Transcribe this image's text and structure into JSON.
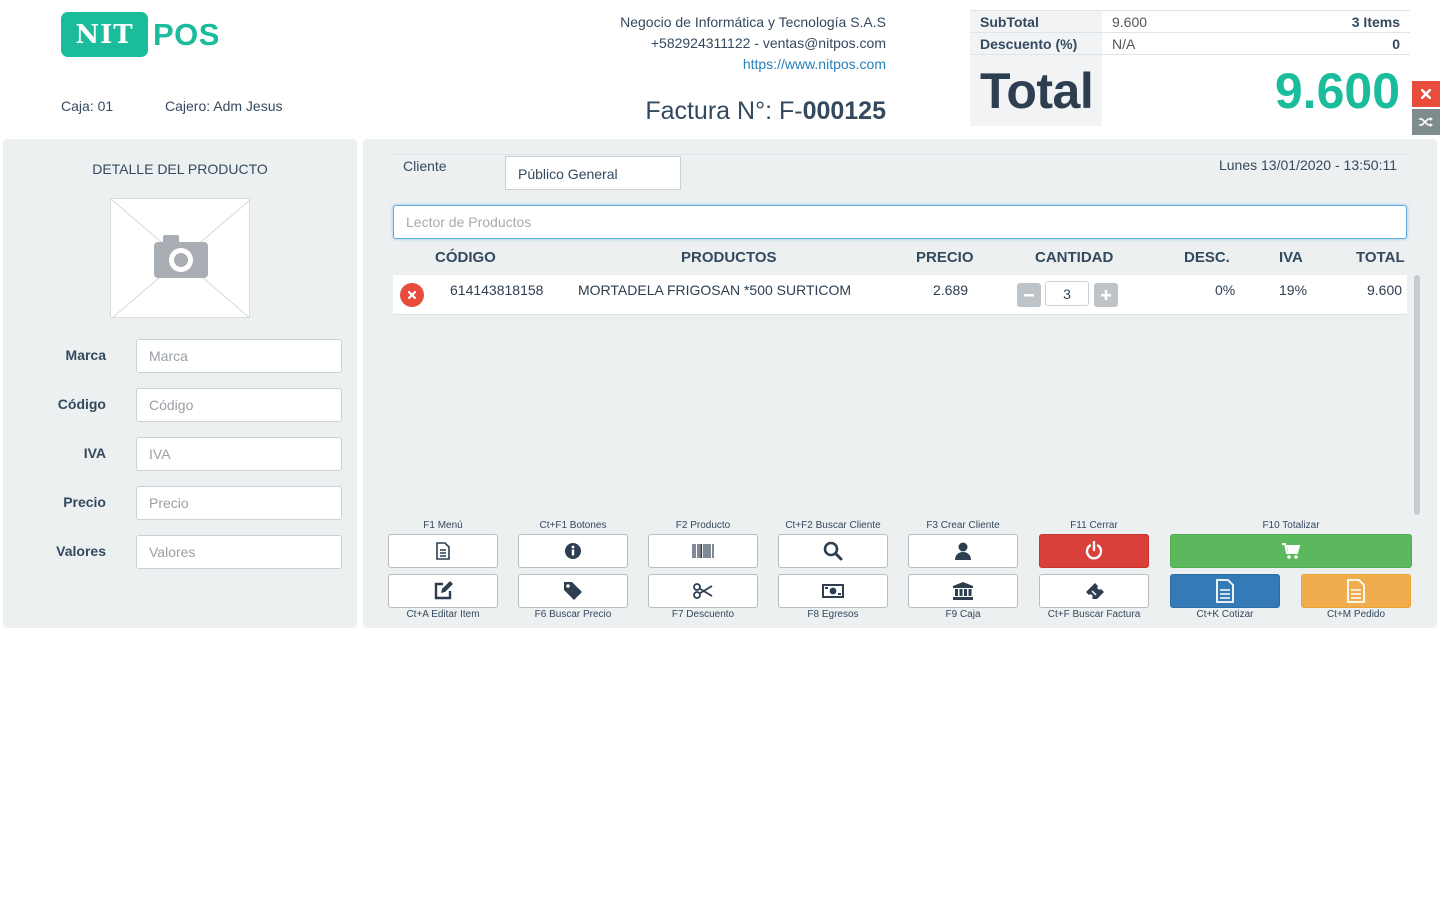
{
  "header": {
    "logo_left": "NIT",
    "logo_right": "POS",
    "caja": "Caja: 01",
    "cajero": "Cajero: Adm Jesus",
    "company_name": "Negocio de Informática y Tecnología S.A.S",
    "company_contact": "+582924311122 - ventas@nitpos.com",
    "company_url": "https://www.nitpos.com",
    "factura_prefix": "Factura N°: F-",
    "factura_number": "000125"
  },
  "totals": {
    "subtotal_label": "SubTotal",
    "subtotal_value": "9.600",
    "items": "3 Items",
    "descuento_label": "Descuento (%)",
    "descuento_value": "N/A",
    "descuento_amount": "0",
    "total_label": "Total",
    "total_value": "9.600"
  },
  "side_buttons": {
    "close_icon": "close-icon",
    "shuffle_icon": "shuffle-icon"
  },
  "detalle": {
    "title": "DETALLE DEL PRODUCTO",
    "photo_icon": "camera-icon",
    "fields": [
      {
        "label": "Marca",
        "placeholder": "Marca"
      },
      {
        "label": "Código",
        "placeholder": "Código"
      },
      {
        "label": "IVA",
        "placeholder": "IVA"
      },
      {
        "label": "Precio",
        "placeholder": "Precio"
      },
      {
        "label": "Valores",
        "placeholder": "Valores"
      }
    ]
  },
  "sale": {
    "cliente_label": "Cliente",
    "cliente_value": "Público General",
    "fecha": "Lunes 13/01/2020 - 13:50:11",
    "lector_placeholder": "Lector de Productos",
    "columns": [
      "CÓDIGO",
      "PRODUCTOS",
      "PRECIO",
      "CANTIDAD",
      "DESC.",
      "IVA",
      "TOTAL"
    ],
    "rows": [
      {
        "codigo": "614143818158",
        "producto": "MORTADELA FRIGOSAN *500 SURTICOM",
        "precio": "2.689",
        "cantidad": "3",
        "desc": "0%",
        "iva": "19%",
        "total": "9.600"
      }
    ]
  },
  "function_keys": {
    "top": [
      {
        "label": "F1 Menú",
        "icon": "document-icon"
      },
      {
        "label": "Ct+F1 Botones",
        "icon": "info-icon"
      },
      {
        "label": "F2 Producto",
        "icon": "barcode-icon"
      },
      {
        "label": "Ct+F2 Buscar Cliente",
        "icon": "search-icon"
      },
      {
        "label": "F3 Crear Cliente",
        "icon": "user-icon"
      },
      {
        "label": "F11 Cerrar",
        "icon": "power-icon"
      },
      {
        "label": "F10 Totalizar",
        "icon": "cart-icon"
      }
    ],
    "bottom": [
      {
        "label": "Ct+A Editar Item",
        "icon": "edit-icon"
      },
      {
        "label": "F6 Buscar Precio",
        "icon": "tag-icon"
      },
      {
        "label": "F7 Descuento",
        "icon": "scissors-icon"
      },
      {
        "label": "F8 Egresos",
        "icon": "money-icon"
      },
      {
        "label": "F9 Caja",
        "icon": "bank-icon"
      },
      {
        "label": "Ct+F Buscar Factura",
        "icon": "ticket-icon"
      },
      {
        "label": "Ct+K Cotizar",
        "icon": "document-icon"
      },
      {
        "label": "Ct+M Pedido",
        "icon": "document-icon"
      }
    ]
  },
  "colors": {
    "brand": "#1abc9c",
    "text": "#34495e",
    "panel": "#ecf0f1",
    "danger": "#d9403a",
    "success": "#5cb85c",
    "primary": "#337ab7",
    "warning": "#f0ad4e"
  }
}
